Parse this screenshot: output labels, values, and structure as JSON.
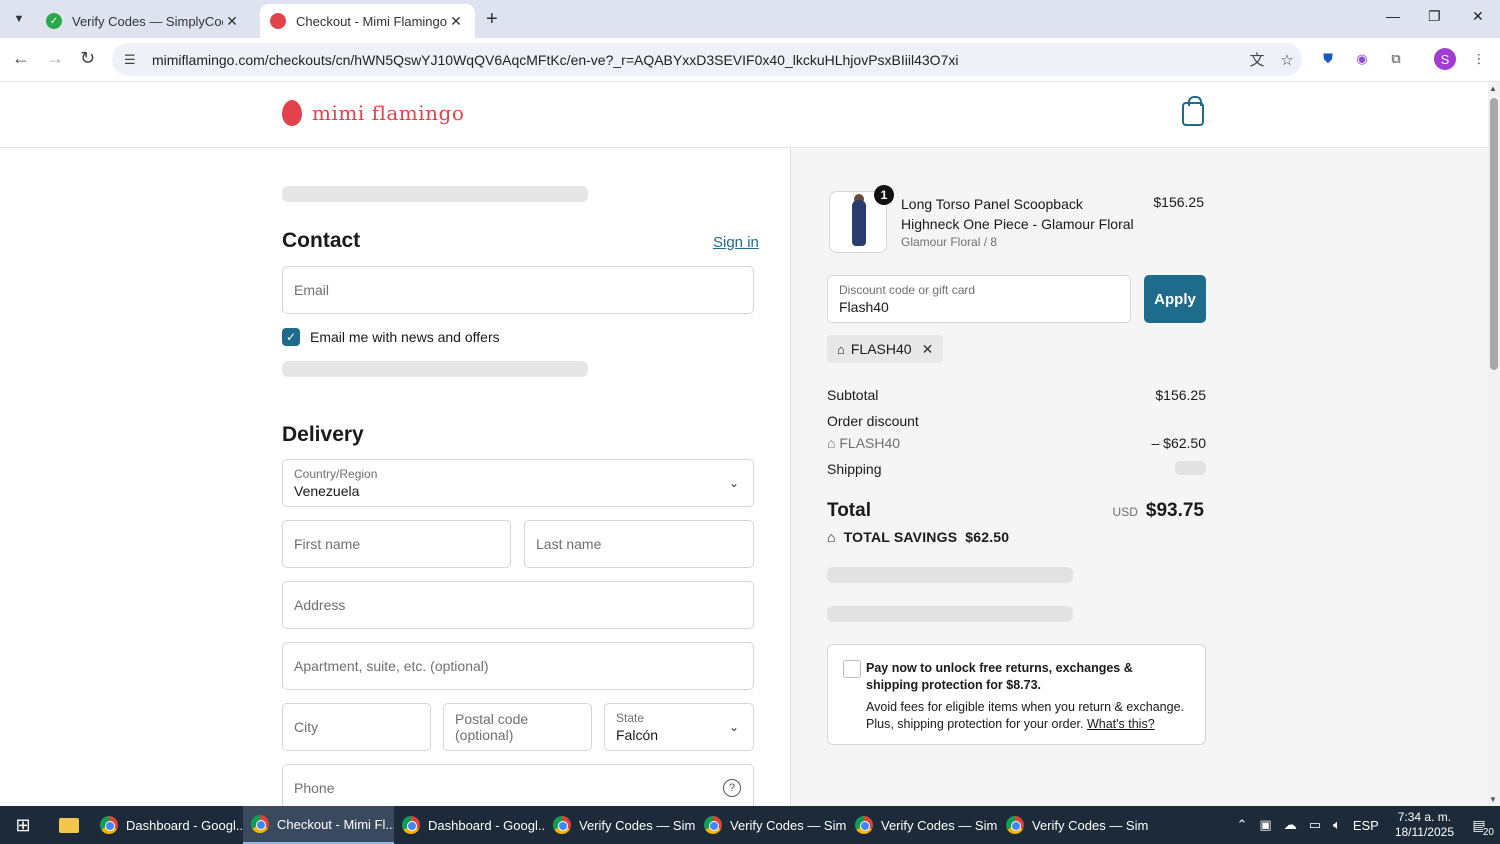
{
  "browser": {
    "tabs": [
      {
        "title": "Verify Codes — SimplyCodes",
        "active": false
      },
      {
        "title": "Checkout - Mimi Flamingo",
        "active": true
      }
    ],
    "url": "mimiflamingo.com/checkouts/cn/hWN5QswYJ10WqQV6AqcMFtKc/en-ve?_r=AQABYxxD3SEVIF0x40_lkckuHLhjovPsxBIiil43O7xi"
  },
  "site": {
    "logo_text": "mimi flamingo"
  },
  "contact": {
    "heading": "Contact",
    "signin_label": "Sign in",
    "email_placeholder": "Email",
    "newsletter_label": "Email me with news and offers",
    "newsletter_checked": true
  },
  "delivery": {
    "heading": "Delivery",
    "country_label": "Country/Region",
    "country_value": "Venezuela",
    "first_name_placeholder": "First name",
    "last_name_placeholder": "Last name",
    "address_placeholder": "Address",
    "apartment_placeholder": "Apartment, suite, etc. (optional)",
    "city_placeholder": "City",
    "postal_placeholder": "Postal code (optional)",
    "state_label": "State",
    "state_value": "Falcón",
    "phone_placeholder": "Phone"
  },
  "summary": {
    "product": {
      "quantity": "1",
      "name": "Long Torso Panel Scoopback Highneck One Piece - Glamour Floral",
      "variant": "Glamour Floral / 8",
      "price": "$156.25"
    },
    "discount_label": "Discount code or gift card",
    "discount_value": "Flash40",
    "apply_label": "Apply",
    "applied_code": "FLASH40",
    "subtotal_label": "Subtotal",
    "subtotal_value": "$156.25",
    "order_discount_label": "Order discount",
    "discount_code_line": "FLASH40",
    "discount_amount": "– $62.50",
    "shipping_label": "Shipping",
    "total_label": "Total",
    "total_currency": "USD",
    "total_value": "$93.75",
    "savings_label": "TOTAL SAVINGS",
    "savings_value": "$62.50",
    "protection": {
      "headline": "Pay now to unlock free returns, exchanges & shipping protection for $8.73.",
      "body": "Avoid fees for eligible items when you return & exchange. Plus, shipping protection for your order.",
      "link": "What's this?"
    }
  },
  "taskbar": {
    "items": [
      {
        "label": "Dashboard - Googl...",
        "active": false
      },
      {
        "label": "Checkout - Mimi Fl...",
        "active": true
      },
      {
        "label": "Dashboard - Googl...",
        "active": false
      },
      {
        "label": "Verify Codes — Sim...",
        "active": false
      },
      {
        "label": "Verify Codes — Sim...",
        "active": false
      },
      {
        "label": "Verify Codes — Sim...",
        "active": false
      },
      {
        "label": "Verify Codes — Sim...",
        "active": false
      }
    ],
    "language": "ESP",
    "time": "7:34 a. m.",
    "date": "18/11/2025",
    "notifications": "20"
  },
  "colors": {
    "accent": "#1f6b8c",
    "brand": "#e2434b"
  }
}
